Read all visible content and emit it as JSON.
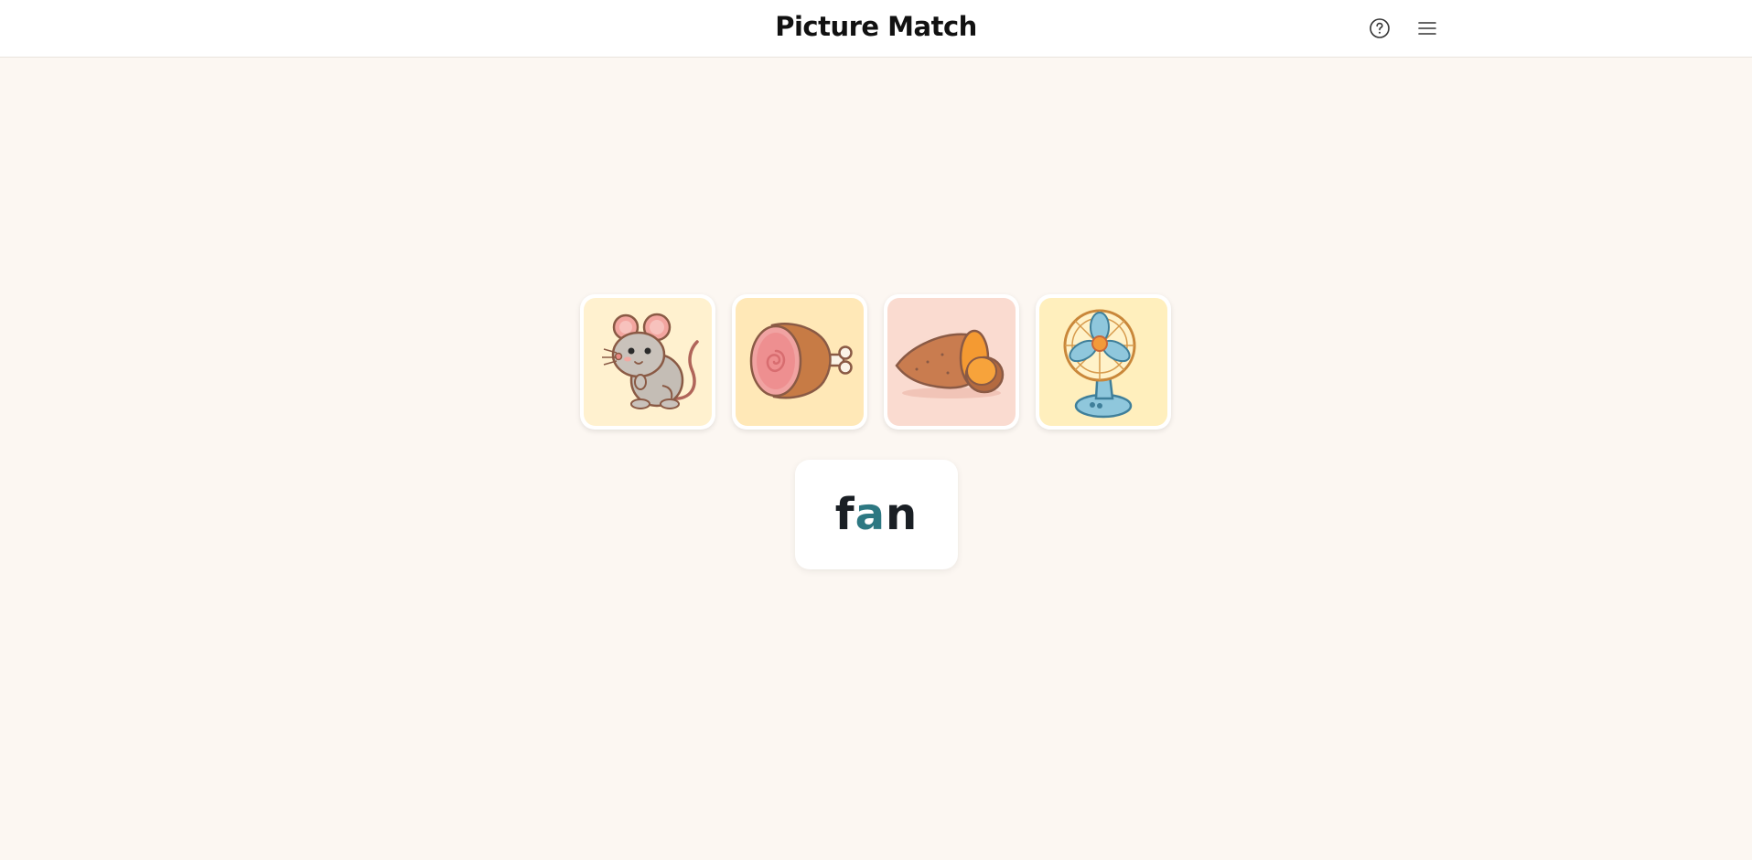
{
  "header": {
    "title": "Picture Match",
    "help_icon": "help-circle-icon",
    "menu_icon": "hamburger-menu-icon"
  },
  "cards": [
    {
      "picture": "mouse",
      "background": "#fff1cf"
    },
    {
      "picture": "ham",
      "background": "#ffe8b7"
    },
    {
      "picture": "sweet-potato",
      "background": "#fadbd0"
    },
    {
      "picture": "fan",
      "background": "#ffefbd"
    }
  ],
  "word": {
    "letters": [
      {
        "char": "f",
        "color": "#1a1f24"
      },
      {
        "char": "a",
        "color": "#2d7882"
      },
      {
        "char": "n",
        "color": "#1a1f24"
      }
    ]
  },
  "colors": {
    "background": "#fcf7f2",
    "accent_vowel": "#2d7882",
    "text": "#1a1f24"
  }
}
